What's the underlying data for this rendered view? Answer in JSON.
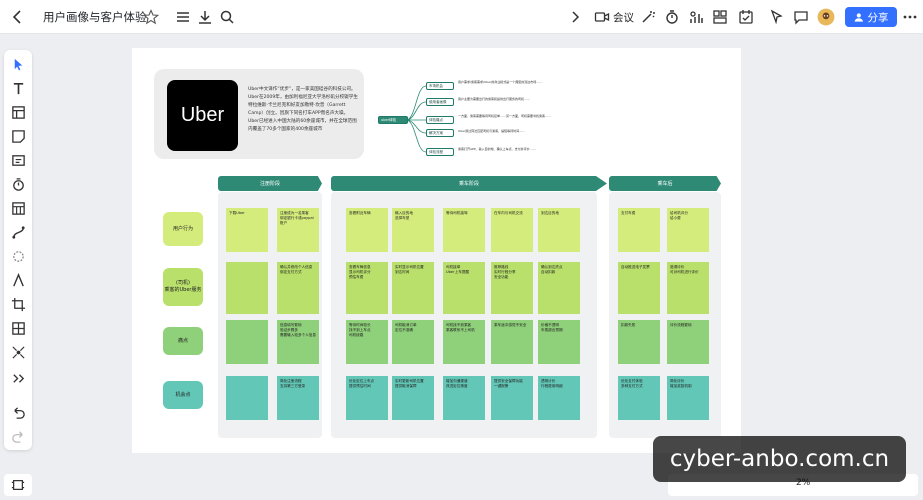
{
  "topbar": {
    "doc_title": "用户画像与客户体验",
    "meeting_label": "会议",
    "share_label": "分享",
    "share_color": "#3370ff",
    "zoom": "2%"
  },
  "uber": {
    "logo_text": "Uber",
    "description": "Uber中文译作“优步”，是一家美国硅谷的科技公司。Uber在2009年，由加利福尼亚大学洛杉矶分校辍学生特拉维斯·卡兰尼克和好友加勒特·坎普（Garrett Camp）创立。因旗下同名打车APP而名声大噪。Uber已经进入中国大陆的60余座城市，并在全球范围内覆盖了70多个国家的400余座城市"
  },
  "mindmap": {
    "root": "uber体验",
    "branches": [
      {
        "label": "市场机会",
        "text": "用户需求/乘客需求/Uber的商业模式是一个典型的双边市场……"
      },
      {
        "label": "使用者画像",
        "text": "用户主要为需要出行的乘客和提供出行服务的司机……"
      },
      {
        "label": "体验痛点",
        "text": "一方面，乘客需要等待司机接单……另一方面，司机需要寻找乘客……"
      },
      {
        "label": "解决方案",
        "text": "Uber通过算法匹配司机与乘客，缩短等待时间……"
      },
      {
        "label": "体验流程",
        "text": "乘客打开APP、输入目的地、确认上车点、支付并评价……"
      }
    ]
  },
  "bands": [
    "注册阶段",
    "乘车阶段",
    "乘车后"
  ],
  "rows": [
    "用户行为",
    "(司机)\n乘客的Uber服务",
    "痛点",
    "机会点"
  ],
  "notes": {
    "r1": [
      "下载Uber",
      "注册成为一名乘客\n绑定银行卡或paypal账户",
      "查看附近车辆",
      "输入目的地\n选择车型",
      "等待司机接驾",
      "在车内与司机交流",
      "到达目的地",
      "支付车费",
      "给司机评分\n给小费"
    ],
    "r2": [
      "",
      "确认并修改个人信息\n绑定支付方式",
      "查看车辆信息\n显示司机评分\n预估车费",
      "实时显示司机位置\n到达时间",
      "司机接单\nUber上车提醒",
      "推荐路线\n实时行程分享\n安全功能",
      "确认到达终点\n自动扣款",
      "自动推送电子发票",
      "邀请评价\n可对司机进行评价"
    ],
    "r3": [
      "",
      "信息填写繁琐\n验证步骤多\n需要输入较多个人信息",
      "等待时间较长\n找不到上车点\n司机绕路",
      "司机取消订单\n定位不准确",
      "司机找不到乘客\n乘客联系不上司机",
      "乘车途中感觉不安全",
      "价格不透明\n车费超出预期",
      "扣款失败",
      "评价流程繁琐"
    ],
    "r4": [
      "",
      "简化注册流程\n支持第三方登录",
      "优化定位上车点\n提供预估时间",
      "实时更新司机位置\n提供取消保障",
      "增加沟通渠道\n改进定位精度",
      "提供安全保障功能\n一键报警",
      "透明计价\n行程费用明细",
      "优化支付体验\n多种支付方式",
      "简化评价\n增加奖励机制"
    ]
  }
}
